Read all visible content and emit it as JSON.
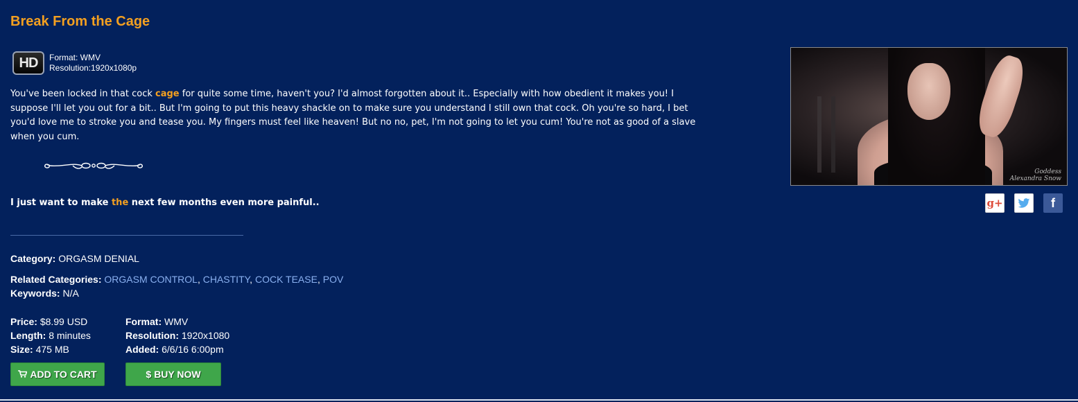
{
  "title": "Break From the Cage",
  "hd": {
    "badge": "HD",
    "format": "Format: WMV",
    "resolution": "Resolution:1920x1080p"
  },
  "description": {
    "before": "You've been locked in that cock ",
    "highlight": "cage",
    "after": " for quite some time, haven't you? I'd almost forgotten about it.. Especially with how obedient it makes you! I suppose I'll let you out for a bit.. But I'm going to put this heavy shackle on to make sure you understand I still own that cock. Oh you're so hard, I bet you'd love me to stroke you and tease you. My fingers must feel like heaven! But no no, pet, I'm not going to let you cum! You're not as good of a slave when you cum."
  },
  "tagline": {
    "before": "I just want to make ",
    "highlight": "the",
    "after": " next few months even more painful.."
  },
  "category": {
    "label": "Category:",
    "value": "ORGASM DENIAL"
  },
  "related": {
    "label": "Related Categories:",
    "items": [
      "ORGASM CONTROL",
      "CHASTITY",
      "COCK TEASE",
      "POV"
    ]
  },
  "keywords": {
    "label": "Keywords:",
    "value": "N/A"
  },
  "specs_left": [
    {
      "label": "Price:",
      "value": "$8.99 USD"
    },
    {
      "label": "Length:",
      "value": "8 minutes"
    },
    {
      "label": "Size:",
      "value": "475 MB"
    }
  ],
  "specs_right": [
    {
      "label": "Format:",
      "value": "WMV"
    },
    {
      "label": "Resolution:",
      "value": "1920x1080"
    },
    {
      "label": "Added:",
      "value": "6/6/16 6:00pm"
    }
  ],
  "buttons": {
    "add_to_cart": "ADD TO CART",
    "buy_now": "BUY NOW",
    "cart_icon": "cart-icon",
    "dollar_icon": "$"
  },
  "thumbnail": {
    "watermark_line1": "Goddess",
    "watermark_line2": "Alexandra Snow"
  },
  "social": {
    "gplus": "g+",
    "facebook": "f"
  },
  "colors": {
    "background": "#03215c",
    "accent": "#f4a020",
    "link": "#8ab0f0",
    "button": "#3fa64a"
  }
}
